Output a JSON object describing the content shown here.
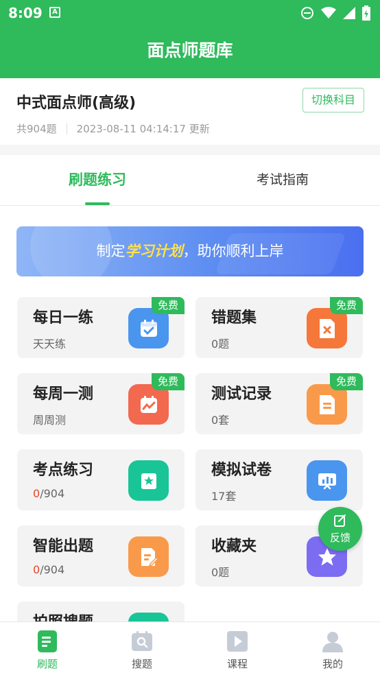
{
  "status_bar": {
    "time": "8:09",
    "notification_letter": "A"
  },
  "app_bar": {
    "title": "面点师题库"
  },
  "subject": {
    "name": "中式面点师(高级)",
    "question_count": "共904题",
    "updated": "2023-08-11 04:14:17 更新",
    "switch_label": "切换科目"
  },
  "tabs": [
    {
      "label": "刷题练习",
      "active": true
    },
    {
      "label": "考试指南",
      "active": false
    }
  ],
  "banner": {
    "prefix": "制定",
    "highlight": "学习计划",
    "suffix": "，助你顺利上岸"
  },
  "cards": [
    {
      "title": "每日一练",
      "sub_red": "",
      "sub": "天天练",
      "badge": "免费",
      "icon": "calendar-check-icon",
      "color": "#4a95ee"
    },
    {
      "title": "错题集",
      "sub_red": "",
      "sub": "0题",
      "badge": "免费",
      "icon": "wrong-file-icon",
      "color": "#f5773a"
    },
    {
      "title": "每周一测",
      "sub_red": "",
      "sub": "周周测",
      "badge": "免费",
      "icon": "weekly-chart-icon",
      "color": "#f2694f"
    },
    {
      "title": "测试记录",
      "sub_red": "",
      "sub": "0套",
      "badge": "免费",
      "icon": "record-file-icon",
      "color": "#f99a4a"
    },
    {
      "title": "考点练习",
      "sub_red": "0",
      "sub": "/904",
      "badge": "",
      "icon": "star-book-icon",
      "color": "#19c597"
    },
    {
      "title": "模拟试卷",
      "sub_red": "",
      "sub": "17套",
      "badge": "",
      "icon": "presentation-icon",
      "color": "#4a95ee"
    },
    {
      "title": "智能出题",
      "sub_red": "0",
      "sub": "/904",
      "badge": "",
      "icon": "edit-doc-icon",
      "color": "#f99a4a"
    },
    {
      "title": "收藏夹",
      "sub_red": "",
      "sub": "0题",
      "badge": "",
      "icon": "star-icon",
      "color": "#7b6cf2"
    },
    {
      "title": "拍照搜题",
      "sub_red": "",
      "sub": "",
      "badge": "",
      "icon": "camera-search-icon",
      "color": "#19c597"
    }
  ],
  "feedback": {
    "label": "反馈"
  },
  "bottom_nav": [
    {
      "label": "刷题",
      "icon": "practice-icon",
      "active": true
    },
    {
      "label": "搜题",
      "icon": "search-icon",
      "active": false
    },
    {
      "label": "课程",
      "icon": "play-icon",
      "active": false
    },
    {
      "label": "我的",
      "icon": "profile-icon",
      "active": false
    }
  ],
  "colors": {
    "brand": "#2fba5c",
    "highlight": "#ffe14a",
    "red": "#e8452c"
  }
}
